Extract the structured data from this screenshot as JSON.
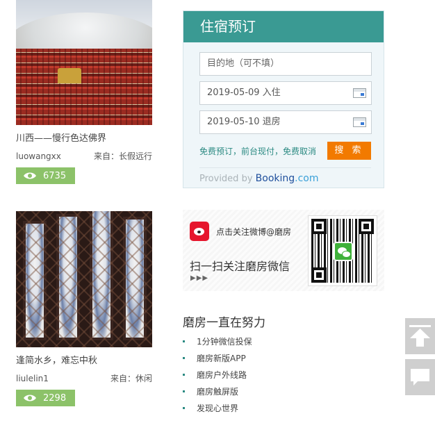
{
  "cards": [
    {
      "title": "川西——慢行色达佛界",
      "author": "luowangxx",
      "from_label": "来自：",
      "from_source": "长假远行",
      "views": "6735",
      "image_icon": "landscape-photo"
    },
    {
      "title": "逢简水乡，难忘中秋",
      "author": "liulelin1",
      "from_label": "来自：",
      "from_source": "休闲",
      "views": "2298",
      "image_icon": "window-lattice-photo"
    }
  ],
  "booking": {
    "title": "住宿预订",
    "destination_placeholder": "目的地（可不填）",
    "checkin": "2019-05-09 入住",
    "checkout": "2019-05-10 退房",
    "promo_text": "免费预订，前台现付，免费取消",
    "search_label": "搜 索",
    "provided_by": "Provided by",
    "brand_booking": "Booking",
    "brand_com": ".com",
    "colors": {
      "header": "#3a9a93",
      "search": "#f27a00"
    }
  },
  "social": {
    "weibo_text": "点击关注微博@磨房",
    "wechat_text": "扫一扫关注磨房微信",
    "arrows": "▶▶▶"
  },
  "effort": {
    "title": "磨房一直在努力",
    "items": [
      "1分钟微信投保",
      "磨房新版APP",
      "磨房户外线路",
      "磨房触屏版",
      "发现心世界"
    ]
  },
  "side_buttons": {
    "top_icon": "arrow-up-icon",
    "chat_icon": "chat-bubble-icon",
    "color": "#cfcfcf"
  },
  "accent_view_badge": "#8cc269"
}
